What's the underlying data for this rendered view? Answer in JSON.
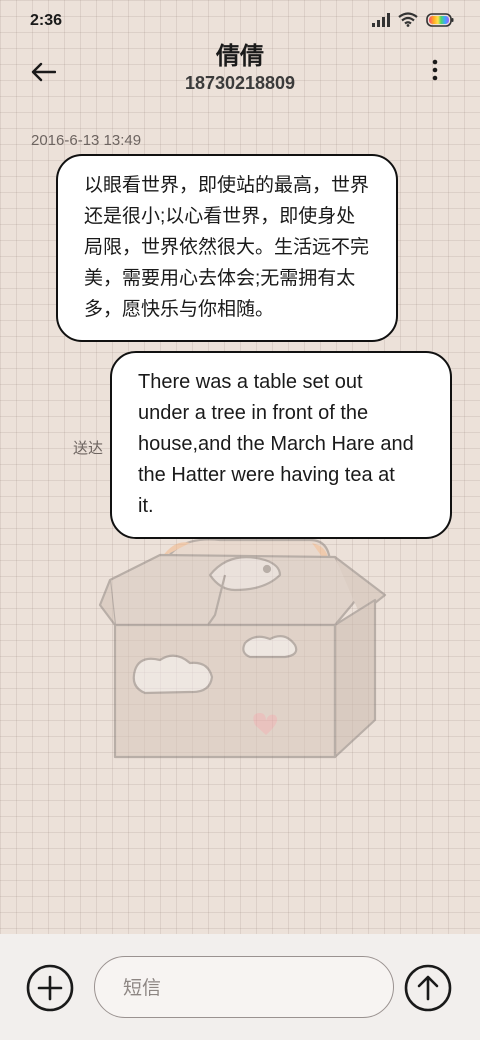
{
  "status_bar": {
    "time": "2:36",
    "icons": [
      "signal-icon",
      "wifi-icon",
      "battery-icon"
    ],
    "battery_colors": [
      "#ff4d6d",
      "#ffb020",
      "#ffe14d",
      "#4cd964",
      "#3ba7ff",
      "#a05cff"
    ]
  },
  "header": {
    "back_icon": "back-arrow-icon",
    "contact_name": "倩倩",
    "contact_number": "18730218809",
    "more_icon": "more-vertical-icon"
  },
  "conversation": {
    "timestamp": "2016-6-13 13:49",
    "incoming": {
      "lines": [
        "以眼看世界，即使站的最高，世界",
        "还是很小;以心看世界，即使身处",
        "局限，世界依然很大。生活远不完",
        "美，需要用心去体会;无需拥有太",
        "多，愿快乐与你相随。"
      ]
    },
    "outgoing": {
      "lines": [
        "There was a table set out",
        "under a tree in front of the",
        "house,and the March Hare and",
        "the Hatter were having tea at",
        "it."
      ],
      "status": "送达"
    }
  },
  "composer": {
    "add_icon": "add-icon",
    "placeholder": "短信",
    "send_icon": "send-arrow-up-icon"
  },
  "background_art": "cat-in-box-illustration"
}
